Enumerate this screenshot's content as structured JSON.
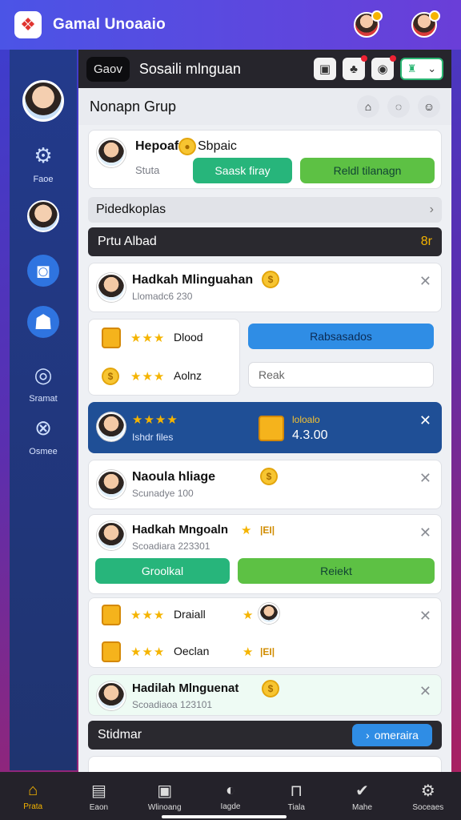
{
  "app": {
    "title": "Gamal Unoaaio"
  },
  "rail": {
    "items": [
      {
        "label": ""
      },
      {
        "label": "Faoe"
      },
      {
        "label": ""
      },
      {
        "label": ""
      },
      {
        "label": ""
      },
      {
        "label": "Sramat"
      },
      {
        "label": "Osmee"
      }
    ]
  },
  "header": {
    "chip": "Gaov",
    "title": "Sosaili mlnguan"
  },
  "group": {
    "title": "Nonapn Grup"
  },
  "request_card": {
    "name": "Hepoaf",
    "name_badge": "Sbpaic",
    "sub": "Stuta",
    "btn_primary": "Saask firay",
    "btn_secondary": "Reldl tilanagn"
  },
  "link_row": {
    "label": "Pidedkoplas"
  },
  "section1": {
    "title": "Prtu Albad",
    "badge": "8r"
  },
  "items": [
    {
      "name": "Hadkah Mlinguahan",
      "sub": "Llomadc6 230"
    },
    {
      "name": "Naoula hliage",
      "sub": "Scunadye 100"
    },
    {
      "name": "Hadkah Mngoaln",
      "sub": "Scoadiara 223301",
      "tag": "|EI|"
    },
    {
      "name": "Hadilah Mlnguenat",
      "sub": "Scoadiaoa 123101"
    }
  ],
  "reward_grid": {
    "row1": {
      "label": "Dlood",
      "button": "Rabsasados"
    },
    "row2": {
      "label": "Aolnz",
      "input_placeholder": "Reak"
    }
  },
  "highlight_card": {
    "label": "Ishdr files",
    "title": "loloalo",
    "value": "4.3.00"
  },
  "action_buttons": {
    "left": "Groolkal",
    "right": "Reiekt"
  },
  "reward_grid2": {
    "row1": {
      "label": "Draiall"
    },
    "row2": {
      "label": "Oeclan",
      "tag": "|EI|"
    }
  },
  "section2": {
    "title": "Stidmar",
    "button": "omeraira"
  },
  "bottom_nav": [
    {
      "label": "Prata",
      "icon": "home-icon"
    },
    {
      "label": "Eaon",
      "icon": "inbox-icon"
    },
    {
      "label": "Wlinoang",
      "icon": "tasks-icon"
    },
    {
      "label": "Iagde",
      "icon": "gift-icon"
    },
    {
      "label": "Tiala",
      "icon": "lock-icon"
    },
    {
      "label": "Mahe",
      "icon": "check-icon"
    },
    {
      "label": "Soceaes",
      "icon": "gear-icon"
    }
  ]
}
